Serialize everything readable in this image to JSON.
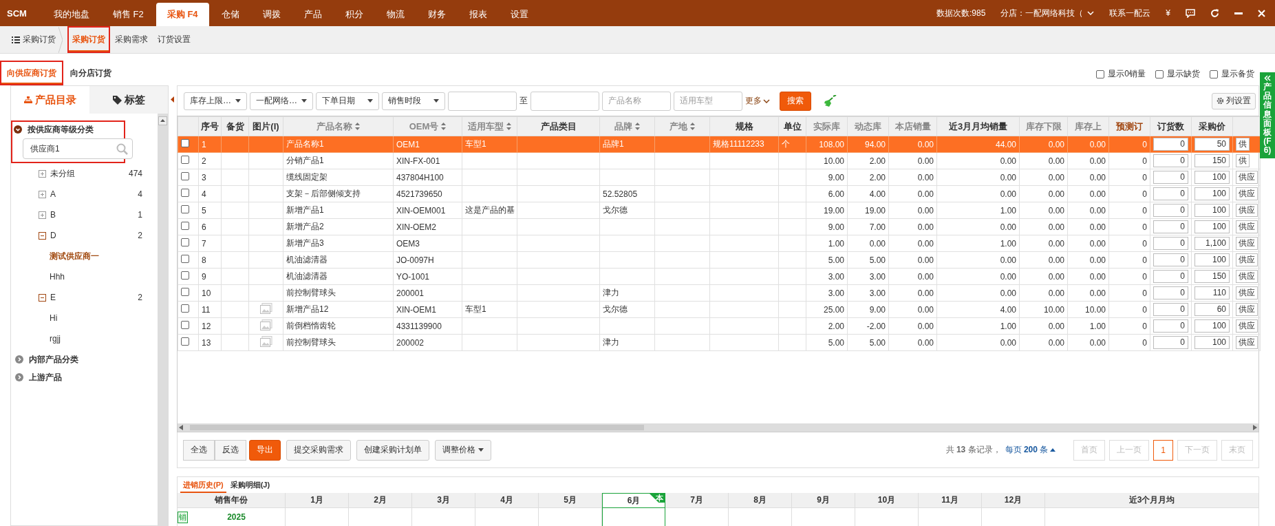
{
  "top_bar": {
    "brand": "SCM",
    "tabs": [
      {
        "label": "我的地盘",
        "selected": false
      },
      {
        "label": "销售 F2",
        "selected": false
      },
      {
        "label": "采购 F4",
        "selected": true
      },
      {
        "label": "仓储",
        "selected": false
      },
      {
        "label": "调拨",
        "selected": false
      },
      {
        "label": "产品",
        "selected": false
      },
      {
        "label": "积分",
        "selected": false
      },
      {
        "label": "物流",
        "selected": false
      },
      {
        "label": "财务",
        "selected": false
      },
      {
        "label": "报表",
        "selected": false
      },
      {
        "label": "设置",
        "selected": false
      }
    ],
    "counter": "数据次数:985",
    "branch": "分店：一配网络科技（",
    "contact": "联系一配云",
    "currency": "¥"
  },
  "breadcrumb": "采购订货",
  "sub_nav": [
    {
      "label": "采购订货",
      "selected": true,
      "highlighted": true
    },
    {
      "label": "采购需求",
      "selected": false,
      "highlighted": false
    },
    {
      "label": "订货设置",
      "selected": false,
      "highlighted": false
    }
  ],
  "order_tabs": [
    {
      "label": "向供应商订货",
      "selected": true,
      "highlighted": true
    },
    {
      "label": "向分店订货",
      "selected": false,
      "highlighted": false
    }
  ],
  "display_options": [
    {
      "label": "显示0销量",
      "checked": false
    },
    {
      "label": "显示缺货",
      "checked": false
    },
    {
      "label": "显示备货",
      "checked": false
    }
  ],
  "side_panel": {
    "label": "产品信息面板(F6)"
  },
  "sidebar": {
    "tabs": [
      {
        "label": "产品目录",
        "selected": true
      },
      {
        "label": "标签",
        "selected": false
      }
    ],
    "sections": [
      {
        "label": "按供应商等级分类",
        "expanded": true,
        "highlighted": true,
        "search": {
          "value": "供应商1"
        },
        "children": [
          {
            "label": "未分组",
            "count": "474",
            "expanded": false
          },
          {
            "label": "A",
            "count": "4",
            "expanded": false
          },
          {
            "label": "B",
            "count": "1",
            "expanded": false
          },
          {
            "label": "D",
            "count": "2",
            "expanded": true,
            "children": [
              {
                "label": "测试供应商一",
                "selected": true
              },
              {
                "label": "Hhh",
                "selected": false
              }
            ]
          },
          {
            "label": "E",
            "count": "2",
            "expanded": true,
            "children": [
              {
                "label": "Hi",
                "selected": false
              },
              {
                "label": "rgjj",
                "selected": false
              }
            ]
          }
        ]
      },
      {
        "label": "内部产品分类",
        "expanded": false,
        "highlighted": false
      },
      {
        "label": "上游产品",
        "expanded": false,
        "highlighted": false
      }
    ]
  },
  "filters": [
    {
      "kind": "select",
      "value": "库存上限…"
    },
    {
      "kind": "select",
      "value": "一配网络…"
    },
    {
      "kind": "select",
      "value": "下单日期"
    },
    {
      "kind": "select",
      "value": "销售时段"
    },
    {
      "kind": "input"
    },
    {
      "kind": "text",
      "label": "至"
    },
    {
      "kind": "input"
    },
    {
      "kind": "input",
      "placeholder": "产品名称"
    },
    {
      "kind": "input",
      "placeholder": "适用车型"
    },
    {
      "kind": "menu",
      "label": "更多"
    }
  ],
  "search_button": "搜索",
  "column_settings": "列设置",
  "table": {
    "columns": [
      {
        "kind": "check"
      },
      {
        "label": "序号",
        "kind": "text",
        "sortable": false
      },
      {
        "label": "备货",
        "kind": "text",
        "sortable": false
      },
      {
        "label": "图片(I)",
        "kind": "image",
        "sortable": false
      },
      {
        "label": "产品名称",
        "kind": "text",
        "sortable": true
      },
      {
        "label": "OEM号",
        "kind": "text",
        "sortable": true
      },
      {
        "label": "适用车型",
        "kind": "text",
        "sortable": true
      },
      {
        "label": "产品类目",
        "kind": "text",
        "sortable": false
      },
      {
        "label": "品牌",
        "kind": "text",
        "sortable": true
      },
      {
        "label": "产地",
        "kind": "text",
        "sortable": true
      },
      {
        "label": "规格",
        "kind": "text",
        "sortable": false
      },
      {
        "label": "单位",
        "kind": "text",
        "sortable": false
      },
      {
        "label": "实际库",
        "kind": "num",
        "sortable": false
      },
      {
        "label": "动态库",
        "kind": "num",
        "sortable": false
      },
      {
        "label": "本店销量",
        "kind": "num",
        "sortable": false
      },
      {
        "label": "近3月月均销量",
        "kind": "num",
        "sortable": false
      },
      {
        "label": "库存下限",
        "kind": "num",
        "sortable": false
      },
      {
        "label": "库存上",
        "kind": "num",
        "sortable": false
      },
      {
        "label": "预测订",
        "kind": "num",
        "sortable": false
      },
      {
        "label": "订货数",
        "kind": "input",
        "sortable": false
      },
      {
        "label": "采购价",
        "kind": "input",
        "sortable": false
      },
      {
        "kind": "button"
      }
    ],
    "rows": [
      {
        "checked": false,
        "selected": true,
        "has_image": false,
        "no": "1",
        "name": "产品名称1",
        "oem": "OEM1",
        "model": "车型1",
        "brand": "品牌1",
        "spec": "规格11112233",
        "unit": "个",
        "actual": "108.00",
        "dynamic": "94.00",
        "sales": "0.00",
        "avg3": "44.00",
        "min": "0.00",
        "max": "0.00",
        "forecast": "0",
        "qty": "0",
        "price": "50",
        "supplier": "供"
      },
      {
        "checked": false,
        "selected": false,
        "has_image": false,
        "no": "2",
        "name": "分销产品1",
        "oem": "XIN-FX-001",
        "actual": "10.00",
        "dynamic": "2.00",
        "sales": "0.00",
        "avg3": "0.00",
        "min": "0.00",
        "max": "0.00",
        "forecast": "0",
        "qty": "0",
        "price": "150",
        "supplier": "供"
      },
      {
        "checked": false,
        "selected": false,
        "has_image": false,
        "no": "3",
        "name": "缆线固定架",
        "oem": "437804H100",
        "actual": "9.00",
        "dynamic": "2.00",
        "sales": "0.00",
        "avg3": "0.00",
        "min": "0.00",
        "max": "0.00",
        "forecast": "0",
        "qty": "0",
        "price": "100",
        "supplier": "供应"
      },
      {
        "checked": false,
        "selected": false,
        "has_image": false,
        "no": "4",
        "name": "支架－后部侧倾支持",
        "oem": "4521739650",
        "brand": "52.52805",
        "actual": "6.00",
        "dynamic": "4.00",
        "sales": "0.00",
        "avg3": "0.00",
        "min": "0.00",
        "max": "0.00",
        "forecast": "0",
        "qty": "0",
        "price": "100",
        "supplier": "供应"
      },
      {
        "checked": false,
        "selected": false,
        "has_image": false,
        "no": "5",
        "name": "新增产品1",
        "oem": "XIN-OEM001",
        "model": "这是产品的基",
        "brand": "戈尔德",
        "actual": "19.00",
        "dynamic": "19.00",
        "sales": "0.00",
        "avg3": "1.00",
        "min": "0.00",
        "max": "0.00",
        "forecast": "0",
        "qty": "0",
        "price": "100",
        "supplier": "供应"
      },
      {
        "checked": false,
        "selected": false,
        "has_image": false,
        "no": "6",
        "name": "新增产品2",
        "oem": "XIN-OEM2",
        "actual": "9.00",
        "dynamic": "7.00",
        "sales": "0.00",
        "avg3": "0.00",
        "min": "0.00",
        "max": "0.00",
        "forecast": "0",
        "qty": "0",
        "price": "100",
        "supplier": "供应"
      },
      {
        "checked": false,
        "selected": false,
        "has_image": false,
        "no": "7",
        "name": "新增产品3",
        "oem": "OEM3",
        "actual": "1.00",
        "dynamic": "0.00",
        "sales": "0.00",
        "avg3": "1.00",
        "min": "0.00",
        "max": "0.00",
        "forecast": "0",
        "qty": "0",
        "price": "1,100",
        "supplier": "供应"
      },
      {
        "checked": false,
        "selected": false,
        "has_image": false,
        "no": "8",
        "name": "机油滤清器",
        "oem": "JO-0097H",
        "actual": "5.00",
        "dynamic": "5.00",
        "sales": "0.00",
        "avg3": "0.00",
        "min": "0.00",
        "max": "0.00",
        "forecast": "0",
        "qty": "0",
        "price": "100",
        "supplier": "供应"
      },
      {
        "checked": false,
        "selected": false,
        "has_image": false,
        "no": "9",
        "name": "机油滤清器",
        "oem": "YO-1001",
        "actual": "3.00",
        "dynamic": "3.00",
        "sales": "0.00",
        "avg3": "0.00",
        "min": "0.00",
        "max": "0.00",
        "forecast": "0",
        "qty": "0",
        "price": "150",
        "supplier": "供应"
      },
      {
        "checked": false,
        "selected": false,
        "has_image": false,
        "no": "10",
        "name": "前控制臂球头",
        "oem": "200001",
        "brand": "津力",
        "actual": "3.00",
        "dynamic": "3.00",
        "sales": "0.00",
        "avg3": "0.00",
        "min": "0.00",
        "max": "0.00",
        "forecast": "0",
        "qty": "0",
        "price": "110",
        "supplier": "供应"
      },
      {
        "checked": false,
        "selected": false,
        "has_image": true,
        "no": "11",
        "name": "新增产品12",
        "oem": "XIN-OEM1",
        "model": "车型1",
        "brand": "戈尔德",
        "actual": "25.00",
        "dynamic": "9.00",
        "sales": "0.00",
        "avg3": "4.00",
        "min": "10.00",
        "max": "10.00",
        "forecast": "0",
        "qty": "0",
        "price": "60",
        "supplier": "供应"
      },
      {
        "checked": false,
        "selected": false,
        "has_image": true,
        "no": "12",
        "name": "前倒档惰齿轮",
        "oem": "4331139900",
        "actual": "2.00",
        "dynamic": "-2.00",
        "sales": "0.00",
        "avg3": "1.00",
        "min": "0.00",
        "max": "1.00",
        "forecast": "0",
        "qty": "0",
        "price": "100",
        "supplier": "供应"
      },
      {
        "checked": false,
        "selected": false,
        "has_image": true,
        "no": "13",
        "name": "前控制臂球头",
        "oem": "200002",
        "brand": "津力",
        "actual": "5.00",
        "dynamic": "5.00",
        "sales": "0.00",
        "avg3": "0.00",
        "min": "0.00",
        "max": "0.00",
        "forecast": "0",
        "qty": "0",
        "price": "100",
        "supplier": "供应"
      }
    ]
  },
  "actions": [
    {
      "label": "全选",
      "kind": "group"
    },
    {
      "label": "反选",
      "kind": "group"
    },
    {
      "label": "导出",
      "kind": "primary"
    },
    {
      "label": "提交采购需求",
      "kind": "default"
    },
    {
      "label": "创建采购计划单",
      "kind": "default"
    },
    {
      "label": "调整价格",
      "kind": "dropdown"
    }
  ],
  "pagination": {
    "summary": "共 **13** 条记录，",
    "page_size": "每页 **200** 条",
    "pages": [
      {
        "label": "首页",
        "selected": false,
        "disabled": true
      },
      {
        "label": "上一页",
        "selected": false,
        "disabled": true
      },
      {
        "label": "1",
        "selected": true,
        "disabled": false
      },
      {
        "label": "下一页",
        "selected": false,
        "disabled": true
      },
      {
        "label": "末页",
        "selected": false,
        "disabled": true
      }
    ]
  },
  "bottom_tabs": [
    {
      "label": "进销历史(P)",
      "selected": true
    },
    {
      "label": "采购明细(J)",
      "selected": false
    }
  ],
  "history": {
    "current_badge": "本",
    "columns": [
      {
        "label": "销售年份",
        "current": false
      },
      {
        "label": "1月",
        "current": false
      },
      {
        "label": "2月",
        "current": false
      },
      {
        "label": "3月",
        "current": false
      },
      {
        "label": "4月",
        "current": false
      },
      {
        "label": "5月",
        "current": false
      },
      {
        "label": "6月",
        "current": true
      },
      {
        "label": "7月",
        "current": false
      },
      {
        "label": "8月",
        "current": false
      },
      {
        "label": "9月",
        "current": false
      },
      {
        "label": "10月",
        "current": false
      },
      {
        "label": "11月",
        "current": false
      },
      {
        "label": "12月",
        "current": false
      },
      {
        "label": "近3个月月均",
        "current": false
      }
    ],
    "rows": [
      {
        "tag": "销",
        "year": "2025"
      }
    ]
  }
}
